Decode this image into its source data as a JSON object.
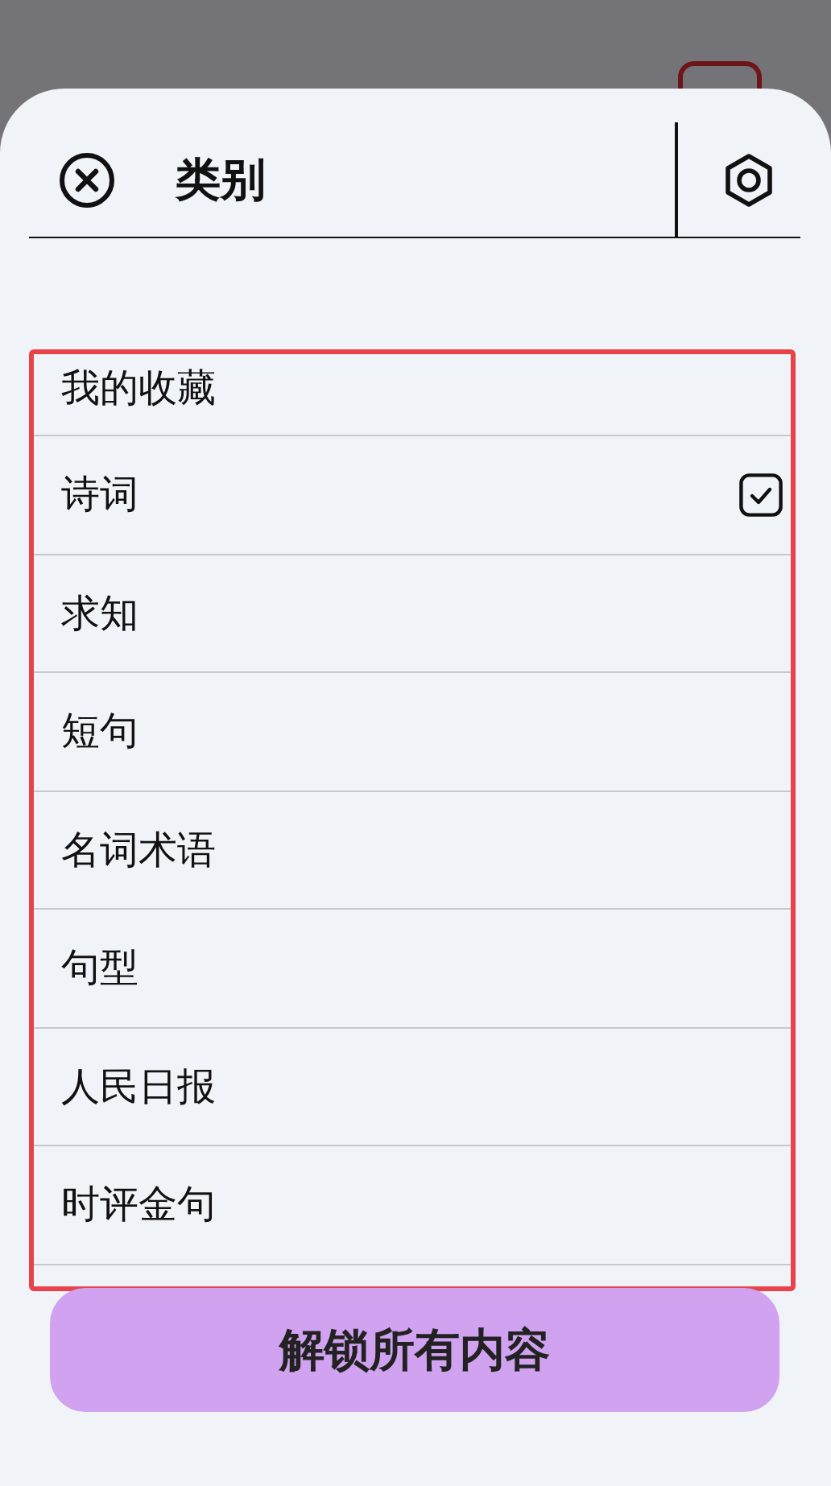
{
  "header": {
    "title": "类别"
  },
  "categories": [
    {
      "label": "我的收藏",
      "checked": false
    },
    {
      "label": "诗词",
      "checked": true
    },
    {
      "label": "求知",
      "checked": false
    },
    {
      "label": "短句",
      "checked": false
    },
    {
      "label": "名词术语",
      "checked": false
    },
    {
      "label": "句型",
      "checked": false
    },
    {
      "label": "人民日报",
      "checked": false
    },
    {
      "label": "时评金句",
      "checked": false
    }
  ],
  "unlock_button": {
    "label": "解锁所有内容"
  }
}
